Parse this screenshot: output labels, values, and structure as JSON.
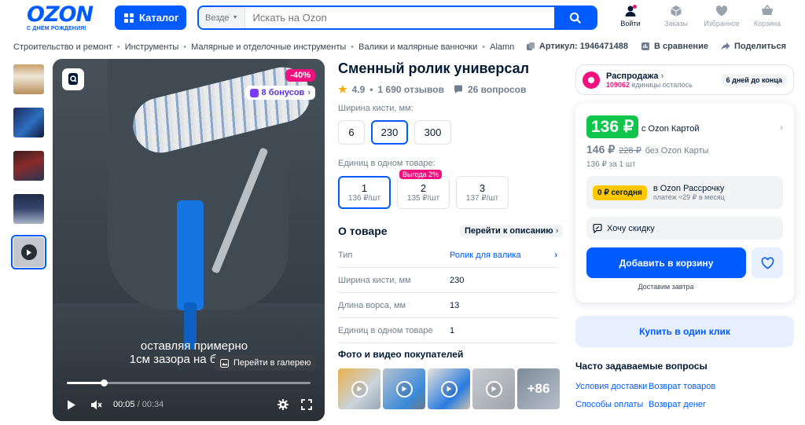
{
  "header": {
    "logo_word": "OZON",
    "logo_tagline": "С ДНЁМ РОЖДЕНИЯ!",
    "catalog_label": "Каталог",
    "search_scope": "Везде",
    "search_placeholder": "Искать на Ozon",
    "nav": [
      {
        "label": "Войти",
        "icon": "user-icon"
      },
      {
        "label": "Заказы",
        "icon": "box-icon"
      },
      {
        "label": "Избранное",
        "icon": "heart-icon"
      },
      {
        "label": "Корзина",
        "icon": "cart-icon"
      }
    ]
  },
  "breadcrumbs": [
    "Строительство и ремонт",
    "Инструменты",
    "Малярные и отделочные инструменты",
    "Валики и малярные ванночки",
    "Alamn"
  ],
  "meta": {
    "article": "Артикул: 1946471488",
    "compare": "В сравнение",
    "share": "Поделиться"
  },
  "media": {
    "discount_badge": "-40%",
    "bonus_badge": "8 бонусов",
    "caption_line1": "оставляя примерно",
    "caption_line2": "1см зазора на бюгеле...",
    "gallery_button": "Перейти в галерею",
    "time_current": "00:05",
    "time_total": "00:34",
    "progress": 0.15
  },
  "product": {
    "title": "Сменный ролик универсал",
    "rating": "4.9",
    "reviews": "1 690 отзывов",
    "questions": "26 вопросов",
    "width_label": "Ширина кисти, мм:",
    "widths": [
      "6",
      "230",
      "300"
    ],
    "pack_label": "Единиц в одном товаре:",
    "packs": [
      {
        "n": "1",
        "price": "136 ₽/шт",
        "tag": ""
      },
      {
        "n": "2",
        "price": "135 ₽/шт",
        "tag": "Выгода 2%"
      },
      {
        "n": "3",
        "price": "137 ₽/шт",
        "tag": ""
      }
    ],
    "about_title": "О товаре",
    "about_link": "Перейти к описанию",
    "specs": [
      {
        "k": "Тип",
        "v": "Ролик для валика"
      },
      {
        "k": "Ширина кисти, мм",
        "v": "230"
      },
      {
        "k": "Длина ворса, мм",
        "v": "13"
      },
      {
        "k": "Единиц в одном товаре",
        "v": "1"
      }
    ],
    "photos_title": "Фото и видео покупателей",
    "photos_more": "+86"
  },
  "buy": {
    "sale_title": "Распродажа",
    "sale_count": "109062",
    "sale_count_suffix": " единицы осталось",
    "sale_days": "6 дней до конца",
    "price_card": "136 ₽",
    "price_card_label": "с Ozon Картой",
    "price": "146 ₽",
    "price_old": "228 ₽",
    "price_no_card": "без Ozon Карты",
    "unit_price": "136 ₽ за 1 шт",
    "installment_badge": "0 ₽ сегодня",
    "installment_title": "в Ozon Рассрочку",
    "installment_sub": "платеж ≈29 ₽ в месяц",
    "want_discount": "Хочу скидку",
    "add_to_cart": "Добавить в корзину",
    "delivery": "Доставим завтра",
    "one_click": "Купить в один клик"
  },
  "faq": {
    "title": "Часто задаваемые вопросы",
    "links": [
      "Условия доставки",
      "Возврат товаров",
      "Способы оплаты",
      "Возврат денег"
    ]
  },
  "colors": {
    "brand": "#005bff",
    "sale": "#f1117e",
    "price": "#10c44c",
    "installment": "#ffc800"
  }
}
